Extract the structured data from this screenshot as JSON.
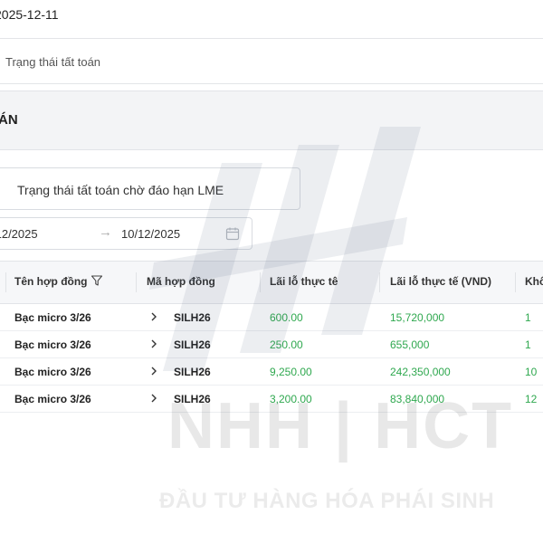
{
  "filters": {
    "date_value": "2025-12-11",
    "status_placeholder": "Trạng thái tất toán"
  },
  "panel": {
    "title": "ÁN"
  },
  "tab": {
    "label": "Trạng thái tất toán chờ đáo hạn LME"
  },
  "date_range": {
    "start": "/12/2025",
    "end": "10/12/2025"
  },
  "table": {
    "headers": {
      "contract_name": "Tên hợp đồng",
      "contract_code": "Mã hợp đồng",
      "pnl": "Lãi lỗ thực tê",
      "pnl_vnd": "Lãi lỗ thực tế (VND)",
      "qty": "Khố"
    },
    "rows": [
      {
        "name": "Bạc micro 3/26",
        "code": "SILH26",
        "pnl": "600.00",
        "pnl_vnd": "15,720,000",
        "qty": "1"
      },
      {
        "name": "Bạc micro 3/26",
        "code": "SILH26",
        "pnl": "250.00",
        "pnl_vnd": "655,000",
        "qty": "1"
      },
      {
        "name": "Bạc micro 3/26",
        "code": "SILH26",
        "pnl": "9,250.00",
        "pnl_vnd": "242,350,000",
        "qty": "10"
      },
      {
        "name": "Bạc micro 3/26",
        "code": "SILH26",
        "pnl": "3,200.00",
        "pnl_vnd": "83,840,000",
        "qty": "12"
      }
    ]
  },
  "watermark": {
    "brand": "NHH | HCT",
    "tagline": "ĐẦU TƯ HÀNG HÓA PHÁI SINH"
  },
  "colors": {
    "positive": "#2fa84f",
    "header_bg": "#f3f4f6"
  }
}
